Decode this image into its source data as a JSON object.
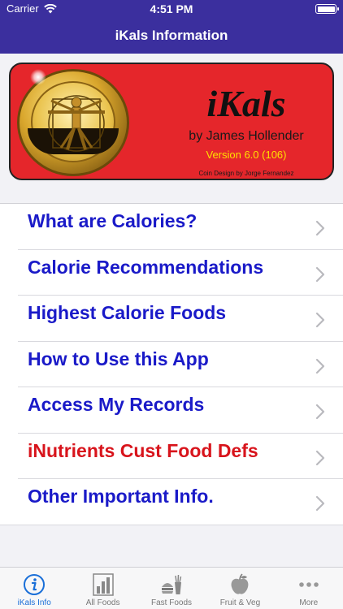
{
  "status_bar": {
    "carrier": "Carrier",
    "time": "4:51 PM"
  },
  "nav": {
    "title": "iKals Information"
  },
  "banner": {
    "brand": "iKals",
    "author": "by James Hollender",
    "version": "Version 6.0 (106)",
    "credit": "Coin Design by Jorge Fernandez"
  },
  "menu": {
    "items": [
      {
        "label": "What are Calories?"
      },
      {
        "label": "Calorie Recommendations"
      },
      {
        "label": "Highest Calorie Foods"
      },
      {
        "label": "How to Use this App"
      },
      {
        "label": "Access My Records"
      },
      {
        "label": "iNutrients Cust Food Defs"
      },
      {
        "label": "Other Important Info."
      }
    ]
  },
  "tabs": [
    {
      "label": "iKals Info",
      "icon": "info-icon"
    },
    {
      "label": "All Foods",
      "icon": "bar-chart-icon"
    },
    {
      "label": "Fast Foods",
      "icon": "fast-food-icon"
    },
    {
      "label": "Fruit & Veg",
      "icon": "fruit-icon"
    },
    {
      "label": "More",
      "icon": "more-icon"
    }
  ],
  "colors": {
    "nav_bg": "#3b2f9e",
    "link_blue": "#1a1ac8",
    "link_red": "#d8141c",
    "banner_red": "#e5262b",
    "tab_active": "#1a6fd8"
  }
}
